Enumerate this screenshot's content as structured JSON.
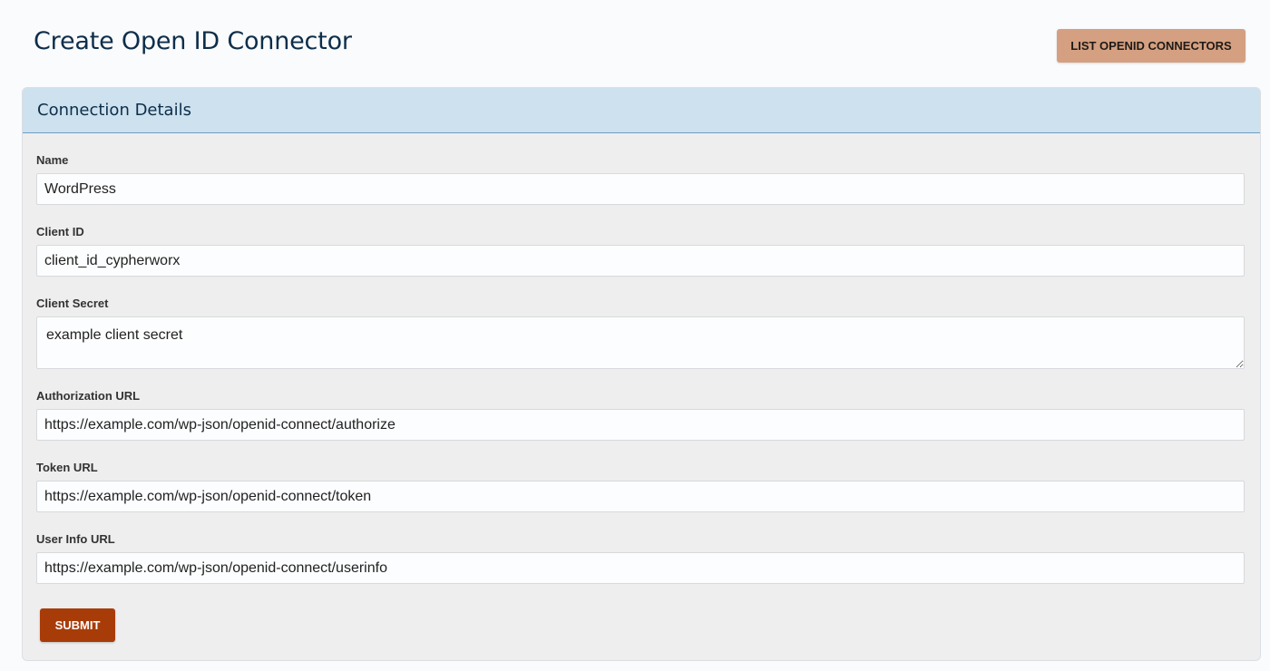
{
  "page": {
    "title": "Create Open ID Connector",
    "list_button_label": "LIST OPENID CONNECTORS"
  },
  "card": {
    "title": "Connection Details",
    "fields": [
      {
        "label": "Name",
        "value": "WordPress",
        "type": "input"
      },
      {
        "label": "Client ID",
        "value": "client_id_cypherworx",
        "type": "input"
      },
      {
        "label": "Client Secret",
        "value": "example client secret",
        "type": "textarea"
      },
      {
        "label": "Authorization URL",
        "value": "https://example.com/wp-json/openid-connect/authorize",
        "type": "input"
      },
      {
        "label": "Token URL",
        "value": "https://example.com/wp-json/openid-connect/token",
        "type": "input"
      },
      {
        "label": "User Info URL",
        "value": "https://example.com/wp-json/openid-connect/userinfo",
        "type": "input"
      }
    ],
    "submit_label": "SUBMIT"
  },
  "colors": {
    "header_bg": "#cde1ee",
    "accent_button": "#d4a081",
    "submit_button": "#a83c08",
    "title_text": "#0d2e4a"
  }
}
